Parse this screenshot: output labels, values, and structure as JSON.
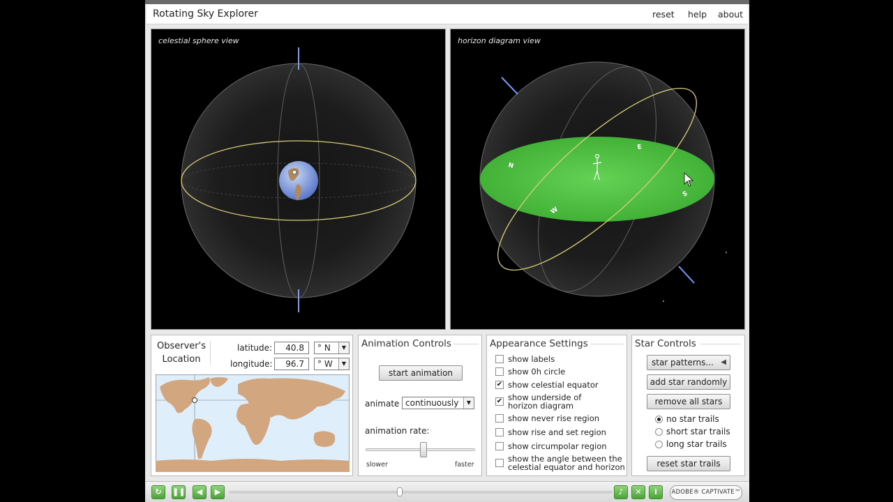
{
  "app": {
    "title": "Rotating Sky Explorer",
    "links": {
      "reset": "reset",
      "help": "help",
      "about": "about"
    }
  },
  "views": {
    "celestial": {
      "label": "celestial sphere view"
    },
    "horizon": {
      "label": "horizon diagram view",
      "cardinals": {
        "n": "N",
        "e": "E",
        "s": "S",
        "w": "W"
      }
    }
  },
  "observer": {
    "title_line1": "Observer's",
    "title_line2": "Location",
    "latitude_label": "latitude:",
    "latitude_value": "40.8",
    "latitude_dir": "° N",
    "longitude_label": "longitude:",
    "longitude_value": "96.7",
    "longitude_dir": "° W"
  },
  "animation": {
    "title": "Animation Controls",
    "start_button": "start animation",
    "animate_label": "animate",
    "animate_value": "continuously",
    "rate_label": "animation rate:",
    "rate_min_label": "slower",
    "rate_max_label": "faster",
    "rate_fraction": 0.53
  },
  "appearance": {
    "title": "Appearance Settings",
    "options": [
      {
        "label": "show labels",
        "checked": false
      },
      {
        "label": "show 0h circle",
        "checked": false
      },
      {
        "label": "show celestial equator",
        "checked": true
      },
      {
        "label_line1": "show underside of",
        "label_line2": "horizon diagram",
        "checked": true
      },
      {
        "label": "show never rise region",
        "checked": false
      },
      {
        "label": "show rise and set region",
        "checked": false
      },
      {
        "label": "show circumpolar region",
        "checked": false
      },
      {
        "label_line1": "show the angle between the",
        "label_line2": "celestial equator and horizon",
        "checked": false
      }
    ]
  },
  "stars": {
    "title": "Star Controls",
    "patterns_button": "star patterns...",
    "add_button": "add star randomly",
    "remove_button": "remove all stars",
    "trails": [
      {
        "label": "no star trails",
        "selected": true
      },
      {
        "label": "short star trails",
        "selected": false
      },
      {
        "label": "long star trails",
        "selected": false
      }
    ],
    "reset_trails_button": "reset star trails"
  },
  "player": {
    "brand": "ADOBE® CAPTIVATE™"
  },
  "colors": {
    "horizon_green": "#4fc441",
    "equator_yellow": "#d8cf7a",
    "land": "#d2a67f",
    "ocean": "#dfeefb"
  }
}
